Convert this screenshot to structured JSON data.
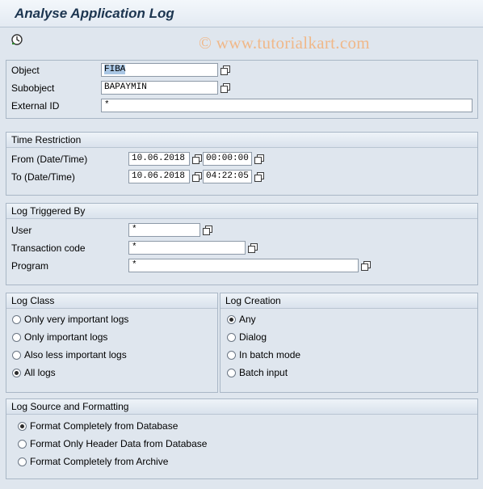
{
  "window": {
    "title": "Analyse Application Log"
  },
  "toolbar": {
    "execute_icon": "clock-execute-icon"
  },
  "watermark": "© www.tutorialkart.com",
  "selection": {
    "object": {
      "label": "Object",
      "value": "FIBA"
    },
    "subobject": {
      "label": "Subobject",
      "value": "BAPAYMIN"
    },
    "external_id": {
      "label": "External ID",
      "value": "*"
    }
  },
  "time_restriction": {
    "heading": "Time Restriction",
    "from": {
      "label": "From (Date/Time)",
      "date": "10.06.2018",
      "time": "00:00:00"
    },
    "to": {
      "label": "To (Date/Time)",
      "date": "10.06.2018",
      "time": "04:22:05"
    }
  },
  "triggered_by": {
    "heading": "Log Triggered By",
    "user": {
      "label": "User",
      "value": "*"
    },
    "transaction": {
      "label": "Transaction code",
      "value": "*"
    },
    "program": {
      "label": "Program",
      "value": "*"
    }
  },
  "log_class": {
    "heading": "Log Class",
    "options": [
      {
        "label": "Only very important logs",
        "selected": false
      },
      {
        "label": "Only important logs",
        "selected": false
      },
      {
        "label": "Also less important logs",
        "selected": false
      },
      {
        "label": "All logs",
        "selected": true
      }
    ]
  },
  "log_creation": {
    "heading": "Log Creation",
    "options": [
      {
        "label": "Any",
        "selected": true
      },
      {
        "label": "Dialog",
        "selected": false
      },
      {
        "label": "In batch mode",
        "selected": false
      },
      {
        "label": "Batch input",
        "selected": false
      }
    ]
  },
  "log_source": {
    "heading": "Log Source and Formatting",
    "options": [
      {
        "label": "Format Completely from Database",
        "selected": true
      },
      {
        "label": "Format Only Header Data from Database",
        "selected": false
      },
      {
        "label": "Format Completely from Archive",
        "selected": false
      }
    ]
  },
  "colors": {
    "background": "#dfe6ee",
    "title": "#1c3550",
    "watermark": "#f0b889"
  }
}
